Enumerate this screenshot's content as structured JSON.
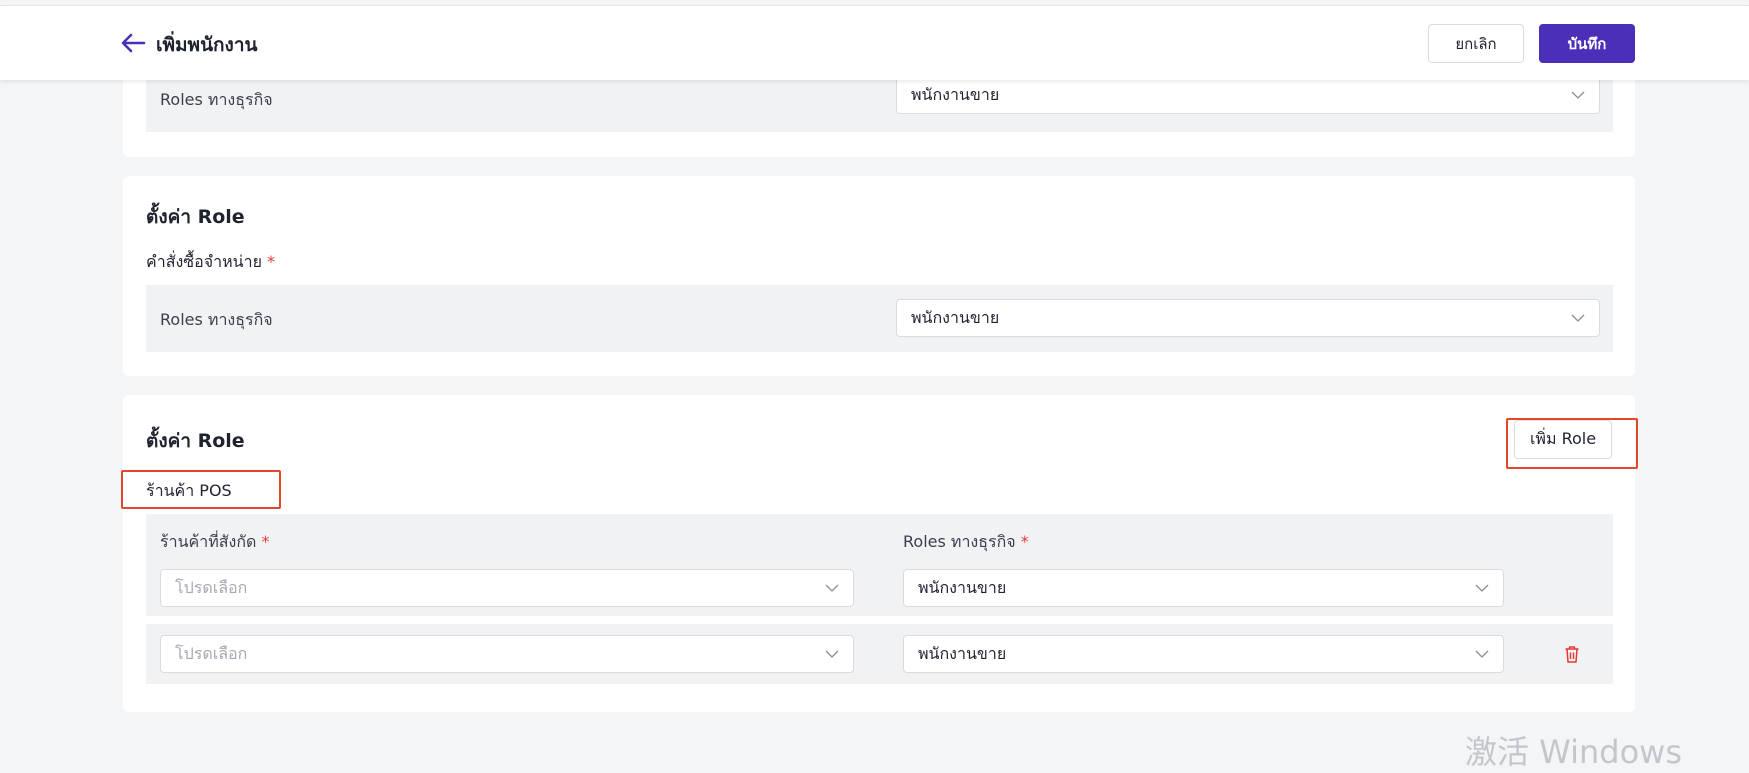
{
  "header": {
    "title": "เพิ่มพนักงาน",
    "cancel_label": "ยกเลิก",
    "save_label": "บันทึก"
  },
  "card_top": {
    "row_label": "Roles ทางธุรกิจ",
    "select_value": "พนักงานขาย"
  },
  "card_role1": {
    "title": "ตั้งค่า Role",
    "field_label": "คำสั่งซื้อจำหน่าย",
    "required_mark": "*",
    "row_label": "Roles ทางธุรกิจ",
    "select_value": "พนักงานขาย"
  },
  "card_role2": {
    "title": "ตั้งค่า Role",
    "add_role_label": "เพิ่ม Role",
    "group_label": "ร้านค้า POS",
    "col_store_label": "ร้านค้าที่สังกัด",
    "col_role_label": "Roles ทางธุรกิจ",
    "required_mark": "*",
    "rows": [
      {
        "store_placeholder": "โปรดเลือก",
        "role_value": "พนักงานขาย"
      },
      {
        "store_placeholder": "โปรดเลือก",
        "role_value": "พนักงานขาย"
      }
    ]
  },
  "watermark": "激活 Windows",
  "colors": {
    "primary": "#4b2fb8",
    "highlight": "#e0482b",
    "danger": "#e53935"
  },
  "icons": [
    "arrow-left-icon",
    "chevron-down-icon",
    "trash-icon"
  ]
}
